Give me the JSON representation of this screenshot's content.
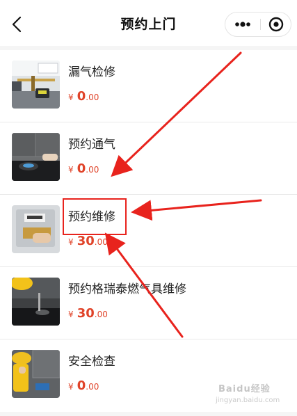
{
  "header": {
    "title": "预约上门"
  },
  "items": [
    {
      "name": "漏气检修",
      "currency": "¥",
      "price_int": "0",
      "price_dec": ".00"
    },
    {
      "name": "预约通气",
      "currency": "¥",
      "price_int": "0",
      "price_dec": ".00"
    },
    {
      "name": "预约维修",
      "currency": "¥",
      "price_int": "30",
      "price_dec": ".00"
    },
    {
      "name": "预约格瑞泰燃气具维修",
      "currency": "¥",
      "price_int": "30",
      "price_dec": ".00"
    },
    {
      "name": "安全检查",
      "currency": "¥",
      "price_int": "0",
      "price_dec": ".00"
    }
  ],
  "watermark": {
    "brand": "Baidu经验",
    "url": "jingyan.baidu.com"
  },
  "colors": {
    "price": "#e0442a",
    "annotation": "#e8231d"
  }
}
